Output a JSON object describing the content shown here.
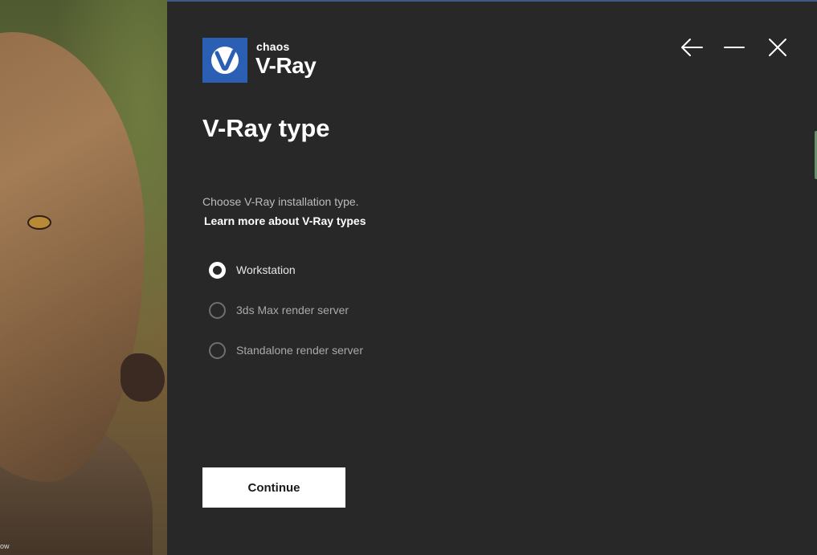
{
  "brand": {
    "company": "chaos",
    "product": "V-Ray",
    "logo_color": "#2b5fb4"
  },
  "window_controls": {
    "back_icon": "arrow-left-icon",
    "minimize_icon": "minimize-icon",
    "close_icon": "close-icon"
  },
  "page": {
    "title": "V-Ray type",
    "subtitle": "Choose V-Ray installation type.",
    "learn_more": "Learn more about V-Ray types"
  },
  "options": [
    {
      "label": "Workstation",
      "selected": true
    },
    {
      "label": "3ds Max render server",
      "selected": false
    },
    {
      "label": "Standalone render server",
      "selected": false
    }
  ],
  "footer": {
    "continue_label": "Continue"
  },
  "image_panel": {
    "credit": "ow"
  },
  "colors": {
    "background": "#282828",
    "accent": "#2b5fb4",
    "button": "#ffffff"
  }
}
